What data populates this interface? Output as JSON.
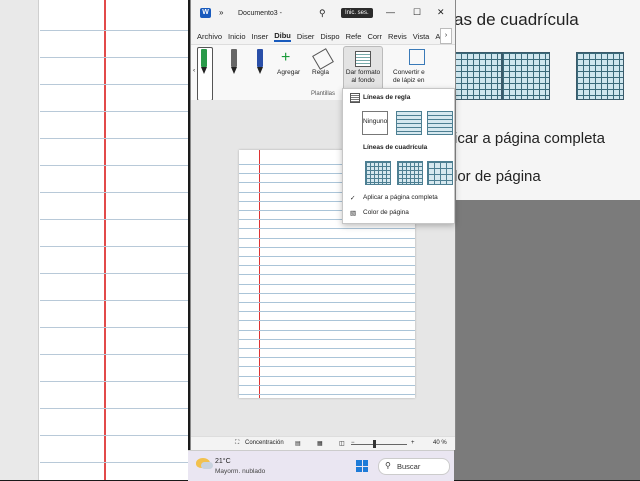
{
  "window": {
    "title": "Documento3  -",
    "signin": "Inic. ses."
  },
  "menu": {
    "items": [
      "Archivo",
      "Inicio",
      "Inser",
      "Dibu",
      "Diser",
      "Dispo",
      "Refe",
      "Corr",
      "Revis",
      "Vista",
      "Ayuc"
    ],
    "active_index": 3
  },
  "ribbon": {
    "add_label": "Agregar",
    "ruler_label": "Regla",
    "bg_format_line1": "Dar formato",
    "bg_format_line2": "al fondo",
    "convert_line1": "Convertir e",
    "convert_line2": "de lápiz en",
    "group_label": "Plantillas"
  },
  "dropdown": {
    "ruled_header": "Líneas de regla",
    "none_label": "Ninguno",
    "grid_header": "Líneas de cuadrícula",
    "apply_full_page": "Aplicar a página completa",
    "page_color": "Color de página"
  },
  "statusbar": {
    "focus": "Concentración",
    "zoom": "40 %"
  },
  "taskbar": {
    "temp": "21°C",
    "weather": "Mayorm. nublado",
    "search": "Buscar"
  },
  "background_zoom": {
    "grid_title": "as de cuadrícula",
    "apply_text": "icar a página completa",
    "page_text": "lor de página"
  },
  "colors": {
    "accent": "#185abd",
    "margin_line": "#e24a4a",
    "ruled_line": "#aac4d8"
  }
}
